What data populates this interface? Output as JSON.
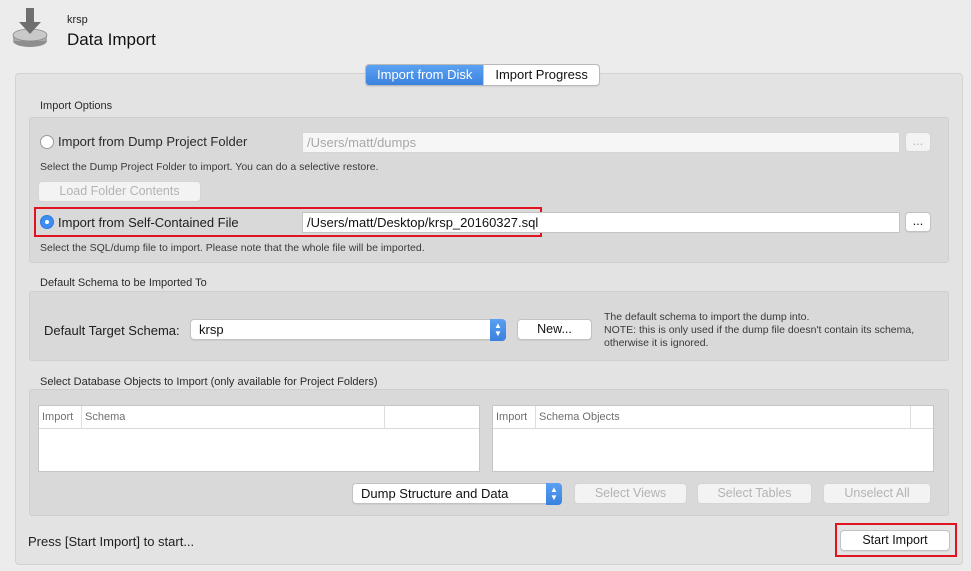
{
  "header": {
    "connection_name": "krsp",
    "title": "Data Import",
    "icon": "import-icon"
  },
  "tabs": [
    {
      "label": "Import from Disk",
      "active": true
    },
    {
      "label": "Import Progress",
      "active": false
    }
  ],
  "import_options": {
    "section_label": "Import Options",
    "dump_folder": {
      "label": "Import from Dump Project Folder",
      "selected": false,
      "path": "/Users/matt/dumps",
      "browse_label": "...",
      "hint": "Select the Dump Project Folder to import. You can do a selective restore.",
      "load_button": "Load Folder Contents"
    },
    "self_contained": {
      "label": "Import from Self-Contained File",
      "selected": true,
      "path": "/Users/matt/Desktop/krsp_20160327.sql",
      "browse_label": "...",
      "hint": "Select the SQL/dump file to import. Please note that the whole file will be imported."
    }
  },
  "default_schema": {
    "section_label": "Default Schema to be Imported To",
    "target_label": "Default Target Schema:",
    "target_value": "krsp",
    "new_button": "New...",
    "note_line1": "The default schema to import the dump into.",
    "note_line2": "NOTE: this is only used if the dump file doesn't contain its schema,",
    "note_line3": "otherwise it is ignored."
  },
  "objects": {
    "section_label": "Select Database Objects to Import (only available for Project Folders)",
    "left_table": {
      "col_import": "Import",
      "col_name": "Schema"
    },
    "right_table": {
      "col_import": "Import",
      "col_name": "Schema Objects"
    },
    "dump_mode": "Dump Structure and Data",
    "select_views": "Select Views",
    "select_tables": "Select Tables",
    "unselect_all": "Unselect All"
  },
  "footer": {
    "status": "Press [Start Import] to start...",
    "start_button": "Start Import"
  },
  "colors": {
    "accent": "#3d8ef0",
    "highlight_box": "#e0141e"
  }
}
